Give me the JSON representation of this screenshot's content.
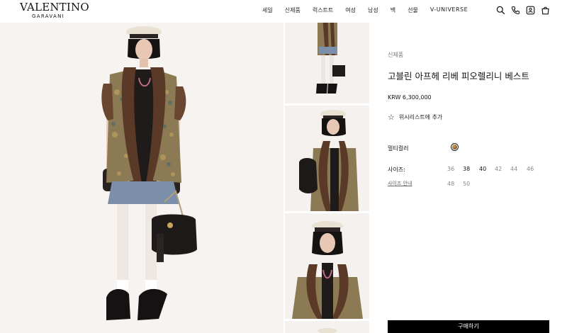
{
  "brand": {
    "name": "VALENTINO",
    "sub": "GARAVANI"
  },
  "nav": [
    "세일",
    "신제품",
    "럭스트트",
    "여성",
    "남성",
    "백",
    "선물",
    "V-UNIVERSE"
  ],
  "header_icons": [
    "search-icon",
    "phone-icon",
    "account-icon",
    "bag-icon"
  ],
  "product": {
    "category": "신제품",
    "title": "고블린 아프헤 리베 피오렐리니 베스트",
    "price": "KRW 6,300,000",
    "wishlist": "위시리스트에 추가",
    "color_label": "멀티컬러",
    "color_swatch": "#9a6e37",
    "size_label": "사이즈:",
    "size_guide": "사이즈 안내",
    "sizes": [
      "36",
      "38",
      "40",
      "42",
      "44",
      "46",
      "48",
      "50"
    ],
    "available_sizes": [
      "38",
      "40"
    ],
    "buy_label": "구매하기"
  },
  "colors": {
    "background": "#ffffff",
    "photo_bg": "#f5f2ef",
    "button": "#000000"
  }
}
